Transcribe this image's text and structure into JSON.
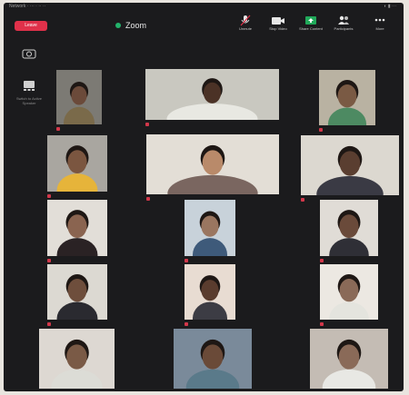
{
  "statusbar": {
    "left": "Network · ··· · ·· ··",
    "right": "◐ ▮ ···"
  },
  "header": {
    "leave_label": "Leave",
    "title": "Zoom"
  },
  "toolbar": [
    {
      "label": "Unmute",
      "icon": "microphone-icon"
    },
    {
      "label": "Stop Video",
      "icon": "video-camera-icon"
    },
    {
      "label": "Share Content",
      "icon": "share-screen-icon"
    },
    {
      "label": "Participants",
      "icon": "participants-icon"
    },
    {
      "label": "More",
      "icon": "more-icon"
    }
  ],
  "sidebar": [
    {
      "label": "",
      "icon": "camera-switch-icon"
    },
    {
      "label": "Switch to Active Speaker",
      "icon": "speaker-view-icon"
    }
  ],
  "participants": [
    {
      "name": "",
      "skin": "#6b4a3a",
      "shirt": "#7a6a4a",
      "bg": "#7c7a74"
    },
    {
      "name": "",
      "skin": "#4b3226",
      "shirt": "#e8e8e2",
      "bg": "#c9c8c0"
    },
    {
      "name": "",
      "skin": "#7a5a44",
      "shirt": "#4d8a62",
      "bg": "#b9b2a2"
    },
    {
      "name": "",
      "skin": "#7b5640",
      "shirt": "#e6b43a",
      "bg": "#a9a6a0"
    },
    {
      "name": "",
      "skin": "#b98a6a",
      "shirt": "#7a6660",
      "bg": "#e3ded6"
    },
    {
      "name": "",
      "skin": "#5a3e30",
      "shirt": "#3a3a44",
      "bg": "#dcd8d0"
    },
    {
      "name": "",
      "skin": "#8a6450",
      "shirt": "#2a2224",
      "bg": "#e2ded8"
    },
    {
      "name": "",
      "skin": "#9a7660",
      "shirt": "#3e5a7a",
      "bg": "#c8d2da"
    },
    {
      "name": "",
      "skin": "#6a4a3a",
      "shirt": "#2f2f36",
      "bg": "#e0dcd6"
    },
    {
      "name": "",
      "skin": "#6e4e3c",
      "shirt": "#2a2a30",
      "bg": "#dcd9d2"
    },
    {
      "name": "",
      "skin": "#5a3c2e",
      "shirt": "#3c3c44",
      "bg": "#e8dcd2"
    },
    {
      "name": "",
      "skin": "#8a6a58",
      "shirt": "#e4e4de",
      "bg": "#ece8e2"
    },
    {
      "name": "",
      "skin": "#7a5a46",
      "shirt": "#dcdcd6",
      "bg": "#ddd8d2"
    },
    {
      "name": "",
      "skin": "#6a4a38",
      "shirt": "#5a7a8a",
      "bg": "#7a8a9a"
    },
    {
      "name": "",
      "skin": "#8a6a58",
      "shirt": "#e8e8e4",
      "bg": "#c4bcb4"
    }
  ],
  "colors": {
    "background": "#1b1b1d",
    "leave": "#e0314a",
    "active_dot": "#23b36b"
  }
}
